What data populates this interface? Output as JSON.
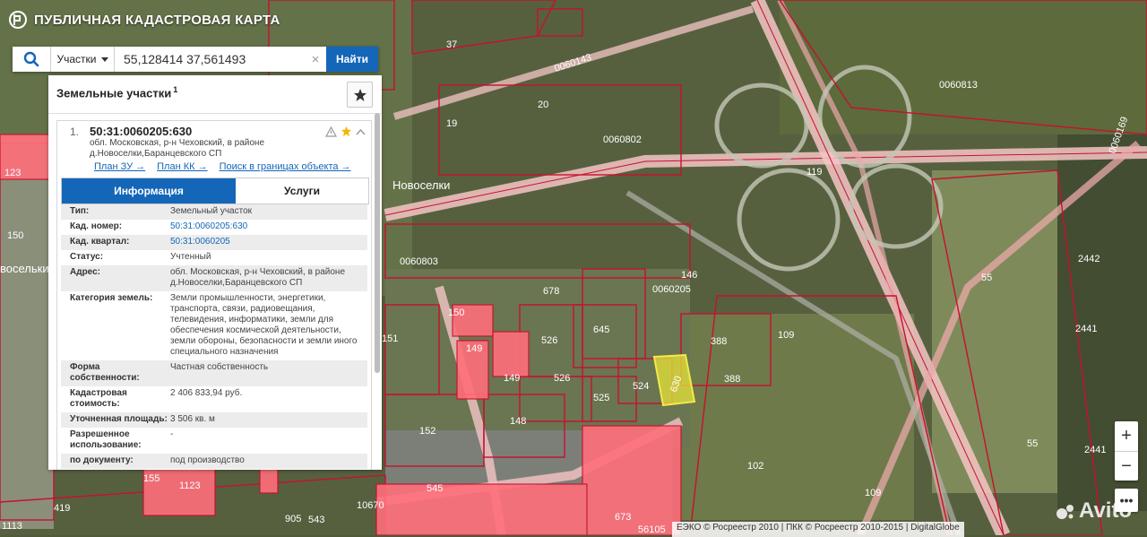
{
  "app": {
    "title": "ПУБЛИЧНАЯ КАДАСТРОВАЯ КАРТА"
  },
  "search": {
    "type_label": "Участки",
    "query": "55,128414 37,561493",
    "find_label": "Найти",
    "clear_symbol": "×"
  },
  "panel": {
    "title": "Земельные участки",
    "title_count": "1",
    "result": {
      "index": "1.",
      "cadastral_number": "50:31:0060205:630",
      "address": "обл. Московская, р-н Чеховский, в районе д.Новоселки,Баранцевского СП",
      "links": [
        "План ЗУ →",
        "План КК →",
        "Поиск в границах объекта →"
      ],
      "tabs": {
        "info": "Информация",
        "services": "Услуги"
      },
      "fields": [
        {
          "key": "Тип:",
          "value": "Земельный участок"
        },
        {
          "key": "Кад. номер:",
          "value": "50:31:0060205:630"
        },
        {
          "key": "Кад. квартал:",
          "value": "50:31:0060205"
        },
        {
          "key": "Статус:",
          "value": "Учтенный"
        },
        {
          "key": "Адрес:",
          "value": "обл. Московская, р-н Чеховский, в районе д.Новоселки,Баранцевского СП"
        },
        {
          "key": "Категория земель:",
          "value": "Земли промышленности, энергетики, транспорта, связи, радиовещания, телевидения, информатики, земли для обеспечения космической деятельности, земли обороны, безопасности и земли иного специального назначения"
        },
        {
          "key": "Форма собственности:",
          "value": "Частная собственность"
        },
        {
          "key": "Кадастровая стоимость:",
          "value": "2 406 833,94 руб."
        },
        {
          "key": "Уточненная площадь:",
          "value": "3 506 кв. м"
        },
        {
          "key": "Разрешенное использование:",
          "value": "-"
        },
        {
          "key": "по документу:",
          "value": "под производство"
        }
      ]
    }
  },
  "map": {
    "labels": {
      "settlement": "Новоселки",
      "settlement_left": "восельки",
      "q_0060813": "0060813",
      "q_0060143": "0060143",
      "q_0060802": "0060802",
      "q_0060803": "0060803",
      "q_0060205": "0060205",
      "q_0060169": "0060169",
      "n119": "119",
      "n630": "630",
      "n388a": "388",
      "n388b": "388",
      "n524": "524",
      "n525": "525",
      "n526a": "526",
      "n526b": "526",
      "n645": "645",
      "n678": "678",
      "n146": "146",
      "n109a": "109",
      "n109b": "109",
      "n102": "102",
      "n55a": "55",
      "n55b": "55",
      "n2442": "2442",
      "n2441a": "2441",
      "n2441b": "2441",
      "n148": "148",
      "n149a": "149",
      "n149b": "149",
      "n150a": "150",
      "n150b": "150",
      "n151": "151",
      "n152": "152",
      "n37": "37",
      "n20": "20",
      "n19": "19",
      "n123": "123",
      "n1123": "1123",
      "n1113": "1113",
      "n419": "419",
      "n905": "905",
      "n543": "543",
      "n673": "673",
      "n56105": "56105",
      "n10670": "10670",
      "n545": "545",
      "n155": "155"
    },
    "zoom_in": "+",
    "zoom_out": "−",
    "more": "•••",
    "attribution": "ЕЭКО © Росреестр 2010 | ПКК © Росреестр 2010-2015 | DigitalGlobe",
    "watermark": "Avito"
  },
  "colors": {
    "accent": "#1466b8",
    "parcel_outline": "#c8102e",
    "selected_parcel": "#e8e43a",
    "road": "#f4c6c6"
  }
}
